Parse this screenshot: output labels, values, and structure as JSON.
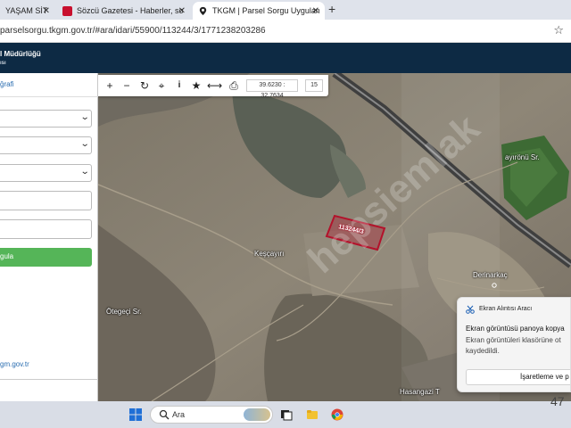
{
  "browser": {
    "tabs": [
      {
        "title": "YAŞAM SİT",
        "close_label": "✕",
        "active": false
      },
      {
        "title": "Sözcü Gazetesi - Haberler, son",
        "close_label": "✕",
        "active": false
      },
      {
        "title": "TKGM | Parsel Sorgu Uygulama",
        "close_label": "✕",
        "active": true
      }
    ],
    "new_tab_label": "+",
    "url": "parselsorgu.tkgm.gov.tr/#ara/idari/55900/113244/3/1771238203286",
    "bookmark_icon": "star-outline-icon"
  },
  "site_header": {
    "line1": "l Müdürlüğü",
    "line2": "ısı"
  },
  "left_panel": {
    "tab_label": "ğrafi",
    "query_button": "gula",
    "footer_link": "gm.gov.tr"
  },
  "map": {
    "toolbar": {
      "buttons": [
        "zoom-in",
        "zoom-out",
        "refresh",
        "locate",
        "info",
        "favorite",
        "measure",
        "print"
      ],
      "coordinates": "39.6230 : 32.7634",
      "zoom": "15"
    },
    "parcel_label": "113244/3",
    "parcel_color": "#b3122b",
    "place_names": {
      "kescayiri": "Keşçayırı",
      "otegeci": "Ötegeçi Sr.",
      "derinarkac": "Derinarkaç",
      "cayironu": "ayırönü Sr.",
      "hasangazi": "Hasangazi T"
    },
    "watermark": "hepsiemlak"
  },
  "notification": {
    "app_name": "Ekran Alıntısı Aracı",
    "title": "Ekran görüntüsü panoya kopya",
    "body_line1": "Ekran görüntüleri klasörüne ot",
    "body_line2": "kaydedildi.",
    "action_label": "İşaretleme ve p"
  },
  "taskbar": {
    "search_placeholder": "Ara",
    "clock_fragment": "47"
  }
}
